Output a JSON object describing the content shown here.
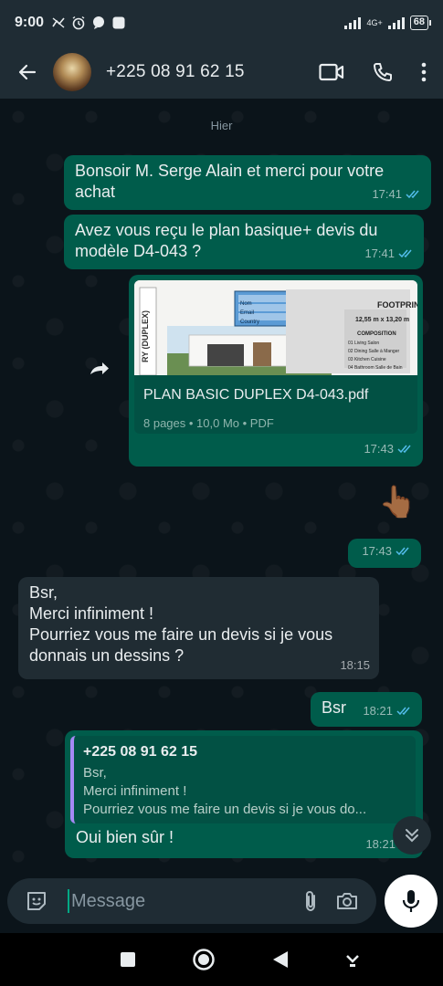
{
  "status": {
    "time": "9:00",
    "network": "4G+",
    "battery": "68"
  },
  "header": {
    "contact": "+225 08 91 62 15"
  },
  "chat": {
    "day_label": "Hier",
    "messages": [
      {
        "text": "Bonsoir M. Serge Alain et merci pour votre achat",
        "time": "17:41"
      },
      {
        "text": "Avez vous reçu le plan basique+ devis du modèle D4-043 ?",
        "time": "17:41"
      },
      {
        "doc_name": "PLAN BASIC DUPLEX D4-043.pdf",
        "doc_meta": "8 pages • 10,0 Mo • PDF",
        "time": "17:43",
        "thumb_title": "FOOTPRINT",
        "thumb_sub": "12,55 m x 13,20 m",
        "thumb_side": "RY (DUPLEX)",
        "thumb_fields": [
          "Nom",
          "Email",
          "Country"
        ],
        "thumb_list": [
          "01 Living Salon",
          "02 Dining Salle à Manger",
          "03 Kitchen Cuisine",
          "04 Bathroom Salle de Bain"
        ],
        "thumb_comp": "COMPOSITION"
      },
      {
        "emoji": "👆🏾",
        "time": "17:43"
      },
      {
        "lines": [
          "Bsr,",
          "Merci infiniment !",
          "Pourriez vous me faire un devis si je vous donnais un dessins ?"
        ],
        "time": "18:15"
      },
      {
        "text": "Bsr",
        "time": "18:21"
      },
      {
        "quote_name": "+225 08 91 62 15",
        "quote_lines": [
          "Bsr,",
          "Merci infiniment !",
          "Pourriez vous me faire un devis si je vous do..."
        ],
        "text": "Oui bien sûr !",
        "time": "18:21"
      }
    ]
  },
  "input": {
    "placeholder": "Message"
  },
  "colors": {
    "outgoing": "#005c4b",
    "incoming": "#202c33",
    "read_tick": "#53bdeb",
    "accent": "#00a884"
  }
}
